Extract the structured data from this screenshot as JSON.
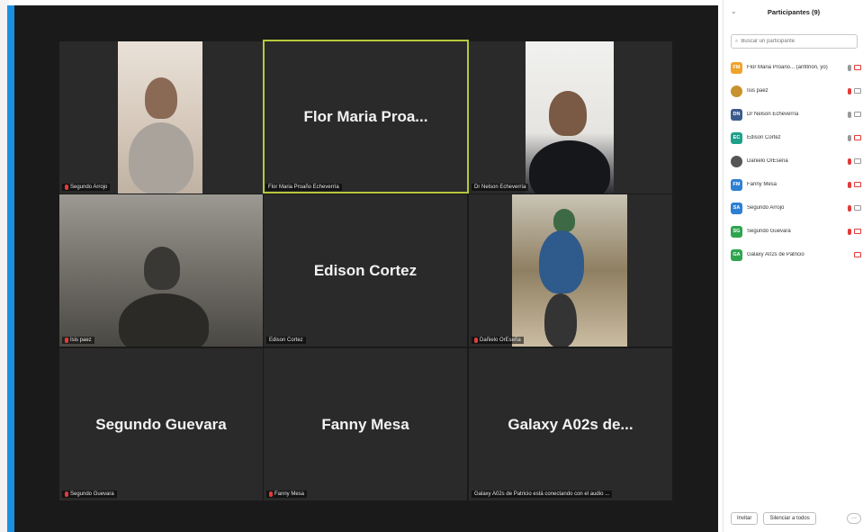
{
  "window": {
    "accent": "#1b8fe0",
    "speaking_border": "#b6c83c",
    "muted_color": "#e23b3b"
  },
  "tiles": [
    {
      "label": "Segundo Arrojo",
      "big_name": "",
      "muted": true,
      "video": true
    },
    {
      "label": "Flor Maria Proaño Echeverría",
      "big_name": "Flor Maria Proa...",
      "muted": false,
      "video": false,
      "speaking": true
    },
    {
      "label": "Dr Nelson Echeverría",
      "big_name": "",
      "muted": false,
      "video": true
    },
    {
      "label": "Isis paez",
      "big_name": "",
      "muted": true,
      "video": true
    },
    {
      "label": "Edison Cortez",
      "big_name": "Edison Cortez",
      "muted": false,
      "video": false
    },
    {
      "label": "Dañielo OrEseña",
      "big_name": "",
      "muted": true,
      "video": true
    },
    {
      "label": "Segundo Guevara",
      "big_name": "Segundo Guevara",
      "muted": true,
      "video": false
    },
    {
      "label": "Fanny Mesa",
      "big_name": "Fanny Mesa",
      "muted": true,
      "video": false
    },
    {
      "label": "Galaxy A02s de Patricio está conectando con el audio ...",
      "big_name": "Galaxy A02s de...",
      "muted": false,
      "video": false
    }
  ],
  "panel": {
    "title": "Participantes (9)",
    "search_placeholder": "Buscar un participante",
    "participants": [
      {
        "initials": "FM",
        "color": "#f0a32a",
        "name": "Flor Maria Proaño... (anfitrión, yo)",
        "mic_off": false,
        "cam_off": true
      },
      {
        "initials": "",
        "color": "#c8922e",
        "name": "Isis paez",
        "mic_off": true,
        "cam_off": false,
        "photo": true
      },
      {
        "initials": "DN",
        "color": "#3a5a8c",
        "name": "Dr Nelson Echeverría",
        "mic_off": false,
        "cam_off": false
      },
      {
        "initials": "EC",
        "color": "#1fa08a",
        "name": "Edison Cortez",
        "mic_off": false,
        "cam_off": true
      },
      {
        "initials": "",
        "color": "#555555",
        "name": "Dañielo OrEseña",
        "mic_off": true,
        "cam_off": false,
        "photo": true
      },
      {
        "initials": "FM",
        "color": "#2d7fd4",
        "name": "Fanny Mesa",
        "mic_off": true,
        "cam_off": true
      },
      {
        "initials": "SA",
        "color": "#2d7fd4",
        "name": "Segundo Arrojo",
        "mic_off": true,
        "cam_off": false
      },
      {
        "initials": "SG",
        "color": "#2fa44f",
        "name": "Segundo Guevara",
        "mic_off": true,
        "cam_off": true
      },
      {
        "initials": "GA",
        "color": "#2fa44f",
        "name": "Galaxy A02s de Patricio",
        "mic_off": false,
        "cam_off": true,
        "no_mic": true
      }
    ],
    "invite_label": "Invitar",
    "mute_all_label": "Silenciar a todos",
    "more_label": "···"
  }
}
